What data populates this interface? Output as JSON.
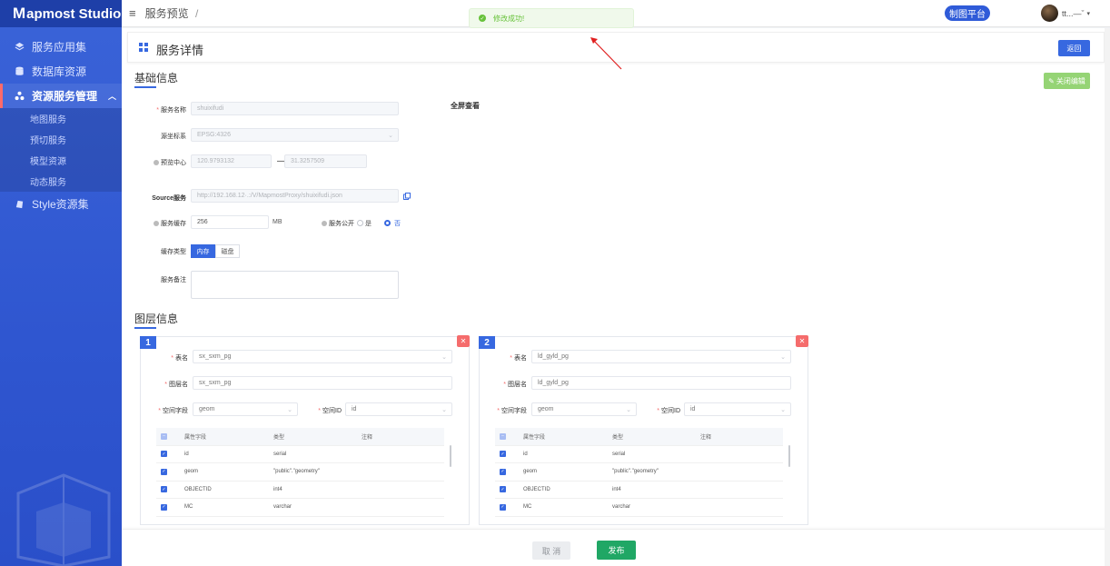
{
  "sidebar": {
    "logo": "apmost Studio",
    "logo_mark": "M",
    "items": [
      {
        "label": "服务应用集"
      },
      {
        "label": "数据库资源"
      },
      {
        "label": "资源服务管理"
      },
      {
        "label": "Style资源集"
      }
    ],
    "submenu": [
      {
        "label": "地图服务"
      },
      {
        "label": "预切服务"
      },
      {
        "label": "模型资源"
      },
      {
        "label": "动态服务"
      }
    ]
  },
  "header": {
    "breadcrumb": "服务预览",
    "breadcrumb_sep": "/",
    "toast": "修改成功!",
    "platform_button": "制图平台",
    "username": "tt...—ˇ"
  },
  "page": {
    "title": "服务详情",
    "back_button": "返回",
    "close_edit_button": "关闭编辑",
    "fullscreen_link": "全屏查看"
  },
  "basic": {
    "section_title": "基础信息",
    "service_name_label": "服务名称",
    "service_name_value": "shuixifudi",
    "crs_label": "源坐标系",
    "crs_value": "EPSG:4326",
    "center_label": "预览中心",
    "center_x": "120.9793132",
    "center_y": "31.3257509",
    "center_sep": "—",
    "source_label": "Source服务",
    "source_value": "http://192.168.12·.:/V/MapmostProxy/shuixifudi.json",
    "cache_label": "服务缓存",
    "cache_value": "256",
    "cache_unit": "MB",
    "public_label": "服务公开",
    "public_yes": "是",
    "public_no": "否",
    "cache_type_label": "缓存类型",
    "cache_type_memory": "内存",
    "cache_type_disk": "磁盘",
    "remark_label": "服务备注"
  },
  "layers": {
    "section_title": "图层信息",
    "cards": [
      {
        "num": "1",
        "table_label": "表名",
        "table_value": "sx_sxm_pg",
        "layer_label": "图层名",
        "layer_value": "sx_sxm_pg",
        "geom_label": "空间字段",
        "geom_value": "geom",
        "id_label": "空间ID",
        "id_value": "id",
        "columns": [
          "属性字段",
          "类型",
          "注释"
        ],
        "rows": [
          [
            "id",
            "serial",
            ""
          ],
          [
            "geom",
            "\"public\".\"geometry\"",
            ""
          ],
          [
            "OBJECTID",
            "int4",
            ""
          ],
          [
            "MC",
            "varchar",
            ""
          ]
        ]
      },
      {
        "num": "2",
        "table_label": "表名",
        "table_value": "ld_gyld_pg",
        "layer_label": "图层名",
        "layer_value": "ld_gyld_pg",
        "geom_label": "空间字段",
        "geom_value": "geom",
        "id_label": "空间ID",
        "id_value": "id",
        "columns": [
          "属性字段",
          "类型",
          "注释"
        ],
        "rows": [
          [
            "id",
            "serial",
            ""
          ],
          [
            "geom",
            "\"public\".\"geometry\"",
            ""
          ],
          [
            "OBJECTID",
            "int4",
            ""
          ],
          [
            "MC",
            "varchar",
            ""
          ]
        ]
      }
    ]
  },
  "footer": {
    "cancel_button": "取 消",
    "publish_button": "发布"
  },
  "colors": {
    "sidebar": "#2f56d0",
    "primary": "#3768e0",
    "success": "#20a765",
    "danger": "#f56c6c",
    "annotation_arrow": "#e02020"
  },
  "icons": [
    "layers-icon",
    "database-icon",
    "cluster-icon",
    "style-icon",
    "menu-icon",
    "check-circle-icon",
    "copy-icon",
    "close-icon",
    "edit-icon",
    "app-icon"
  ]
}
